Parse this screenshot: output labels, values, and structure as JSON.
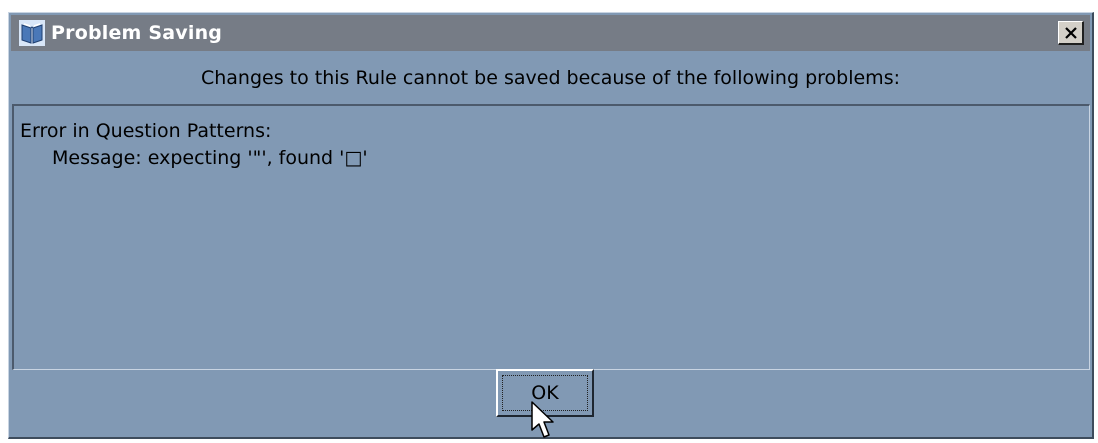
{
  "background_text": "",
  "window": {
    "title": "Problem Saving",
    "close_label": "X"
  },
  "message": "Changes to this Rule cannot be saved because of the following problems:",
  "problems": {
    "line1": "Error in Question Patterns:",
    "line2": "Message: expecting '\"', found '□'"
  },
  "buttons": {
    "ok_label": "OK"
  },
  "colors": {
    "dialog_bg": "#8199b4",
    "titlebar_bg": "#767c86",
    "title_text": "#ffffff"
  }
}
